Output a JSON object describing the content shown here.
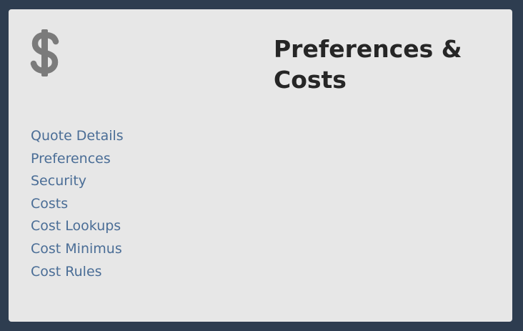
{
  "header": {
    "icon": "dollar-icon",
    "title": "Preferences & Costs"
  },
  "nav": {
    "items": [
      {
        "label": "Quote Details"
      },
      {
        "label": "Preferences"
      },
      {
        "label": "Security"
      },
      {
        "label": "Costs"
      },
      {
        "label": "Cost Lookups"
      },
      {
        "label": "Cost Minimus"
      },
      {
        "label": "Cost Rules"
      }
    ]
  },
  "colors": {
    "background": "#2e3d50",
    "card": "#e7e7e7",
    "icon": "#7b7b7b",
    "title": "#262626",
    "link": "#4a6d96"
  }
}
